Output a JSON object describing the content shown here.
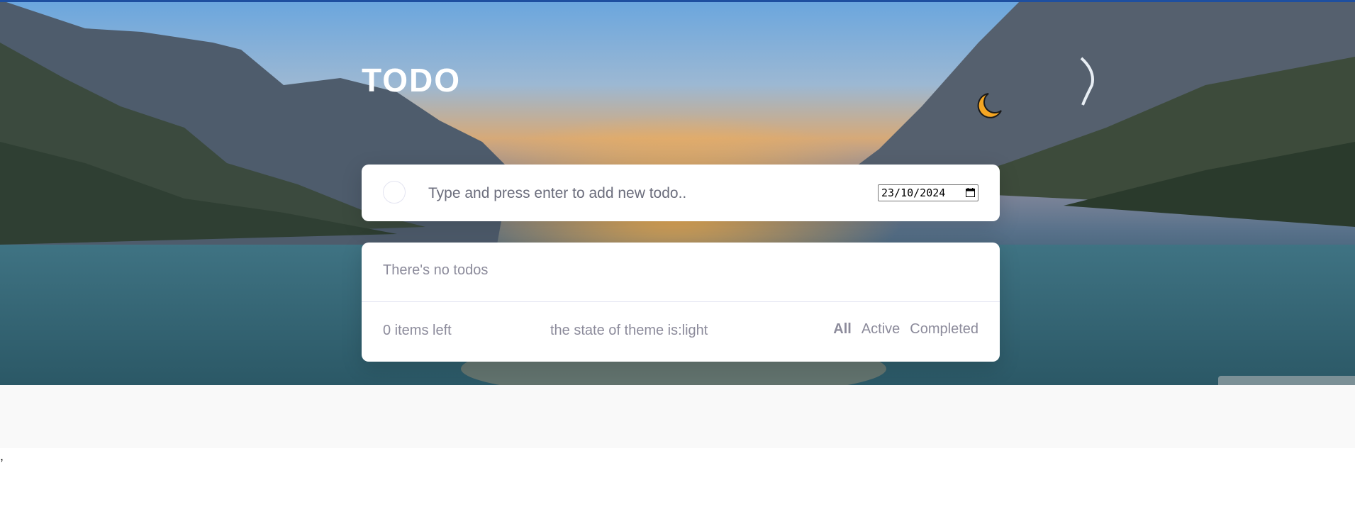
{
  "app": {
    "title": "TODO"
  },
  "theme_toggle": {
    "icon": "moon-icon",
    "color": "#f5a623"
  },
  "new_todo": {
    "placeholder": "Type and press enter to add new todo..",
    "value": "",
    "date": "23/10/2024"
  },
  "list": {
    "empty_message": "There's no todos",
    "items_left": "0 items left",
    "theme_state": "the state of theme is:light"
  },
  "filters": [
    {
      "label": "All",
      "active": true
    },
    {
      "label": "Active",
      "active": false
    },
    {
      "label": "Completed",
      "active": false
    }
  ],
  "page": {
    "stray_text": ","
  },
  "colors": {
    "accent_bar": "#1e4fa0",
    "card_bg": "#ffffff",
    "muted_text": "#8c8b9b"
  }
}
